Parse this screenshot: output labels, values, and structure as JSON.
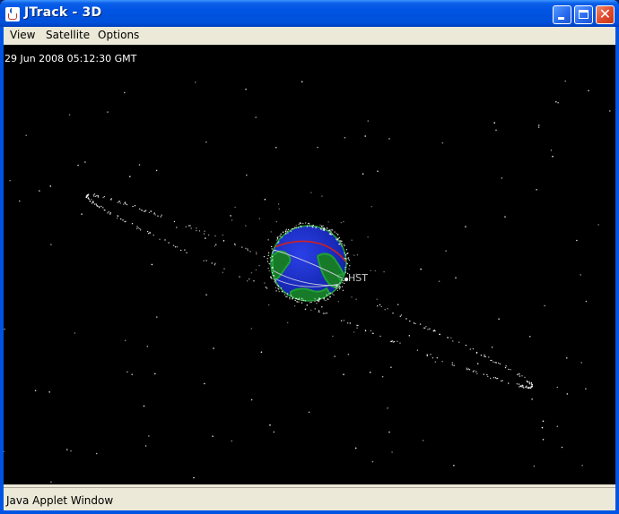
{
  "window": {
    "title": "JTrack - 3D",
    "icon": "java-cup-icon"
  },
  "menu": {
    "items": [
      "View",
      "Satellite",
      "Options"
    ]
  },
  "view": {
    "timestamp": "29 Jun 2008 05:12:30 GMT",
    "satellite_label": "HST"
  },
  "status": {
    "text": "Java Applet Window"
  },
  "colors": {
    "title_bar": "#0054e3",
    "space": "#000000",
    "earth_ocean": "#1a2fd0",
    "land": "#1fa035",
    "orbit_track": "#d02020",
    "ground_tracks": "#c8c8e0",
    "satellites": "#ffffff",
    "label": "#c8c8c8"
  }
}
